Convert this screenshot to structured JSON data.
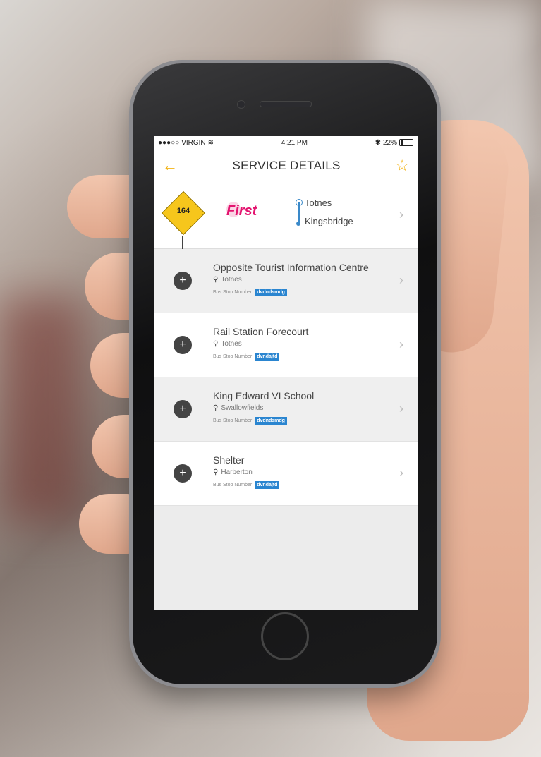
{
  "status_bar": {
    "carrier": "VIRGIN",
    "time": "4:21 PM",
    "battery": "22%"
  },
  "nav": {
    "title": "SERVICE DETAILS"
  },
  "service": {
    "route_number": "164",
    "operator": "First",
    "from": "Totnes",
    "to": "Kingsbridge"
  },
  "stops": [
    {
      "name": "Opposite Tourist Information Centre",
      "area": "Totnes",
      "number_label": "Bus Stop Number",
      "number": "dvdndsmdg"
    },
    {
      "name": "Rail Station Forecourt",
      "area": "Totnes",
      "number_label": "Bus Stop Number",
      "number": "dvndajtd"
    },
    {
      "name": "King Edward VI School",
      "area": "Swallowfields",
      "number_label": "Bus Stop Number",
      "number": "dvdndsmdg"
    },
    {
      "name": "Shelter",
      "area": "Harberton",
      "number_label": "Bus Stop Number",
      "number": "dvndajtd"
    }
  ],
  "icons": {
    "back": "back-arrow-icon",
    "favorite": "star-icon",
    "add": "plus-icon",
    "location": "pin-icon",
    "more": "chevron-right-icon"
  },
  "colors": {
    "accent": "#f3b315",
    "operator": "#e3146f",
    "badge": "#2a85d0"
  }
}
